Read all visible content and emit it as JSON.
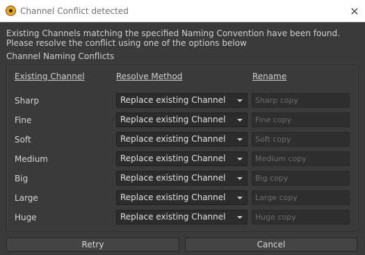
{
  "window": {
    "title": "Channel Conflict detected",
    "close_glyph": "✕"
  },
  "message": {
    "line1": "Existing Channels matching the specified Naming Convention have been found.",
    "line2": "Please resolve the conflict using one of the options below"
  },
  "group": {
    "title": "Channel Naming Conflicts",
    "headers": {
      "existing": "Existing Channel",
      "resolve": "Resolve Method",
      "rename": "Rename"
    }
  },
  "rows": [
    {
      "channel": "Sharp",
      "method": "Replace existing Channel",
      "rename_placeholder": "Sharp copy"
    },
    {
      "channel": "Fine",
      "method": "Replace existing Channel",
      "rename_placeholder": "Fine copy"
    },
    {
      "channel": "Soft",
      "method": "Replace existing Channel",
      "rename_placeholder": "Soft copy"
    },
    {
      "channel": "Medium",
      "method": "Replace existing Channel",
      "rename_placeholder": "Medium copy"
    },
    {
      "channel": "Big",
      "method": "Replace existing Channel",
      "rename_placeholder": "Big copy"
    },
    {
      "channel": "Large",
      "method": "Replace existing Channel",
      "rename_placeholder": "Large copy"
    },
    {
      "channel": "Huge",
      "method": "Replace existing Channel",
      "rename_placeholder": "Huge copy"
    }
  ],
  "buttons": {
    "retry": "Retry",
    "cancel": "Cancel"
  }
}
